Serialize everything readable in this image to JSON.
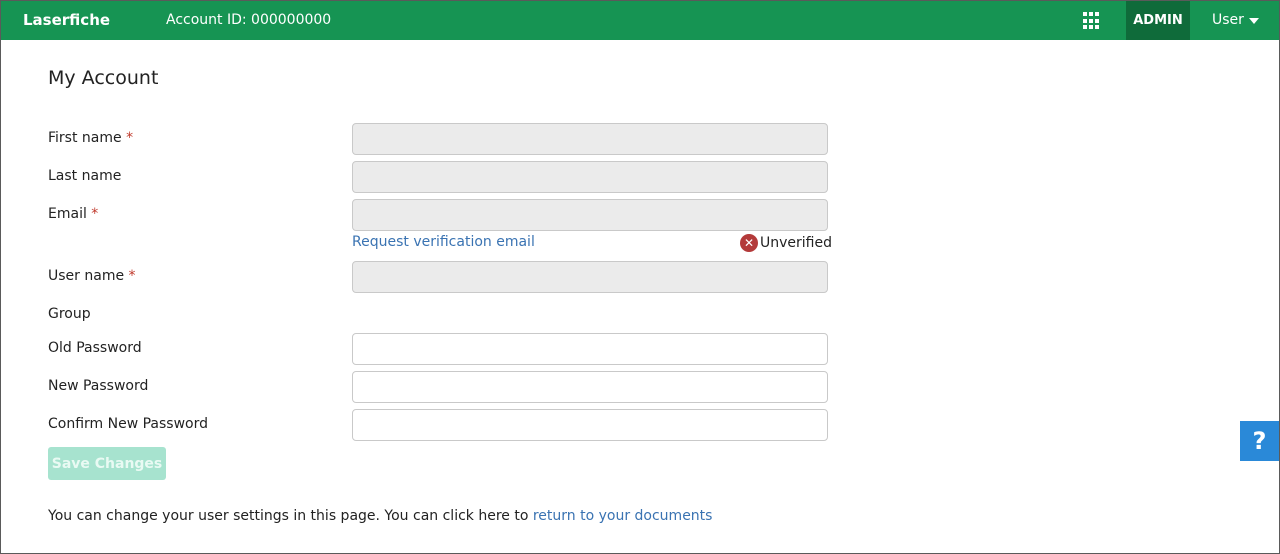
{
  "header": {
    "brand": "Laserfiche",
    "account_id": "Account ID: 000000000",
    "apps_icon": "grid-icon",
    "admin_label": "ADMIN",
    "user_label": "User"
  },
  "page": {
    "title": "My Account"
  },
  "form": {
    "first_name": {
      "label": "First name",
      "required": "*",
      "value": ""
    },
    "last_name": {
      "label": "Last name",
      "value": ""
    },
    "email": {
      "label": "Email",
      "required": "*",
      "value": ""
    },
    "request_verification": "Request verification email",
    "verification_status": "Unverified",
    "verification_icon": "x-circle-icon",
    "user_name": {
      "label": "User name",
      "required": "*",
      "value": ""
    },
    "group": {
      "label": "Group"
    },
    "old_password": {
      "label": "Old Password",
      "value": ""
    },
    "new_password": {
      "label": "New Password",
      "value": ""
    },
    "confirm_password": {
      "label": "Confirm New Password",
      "value": ""
    },
    "save_label": "Save Changes"
  },
  "footer": {
    "text": "You can change your user settings in this page. You can click here to ",
    "link": "return to your documents"
  },
  "help": {
    "label": "?"
  },
  "colors": {
    "header_bg": "#169453",
    "admin_bg": "#0f6b3a",
    "link": "#3a73b2",
    "required": "#c0392b",
    "help_bg": "#2a89d8",
    "save_disabled": "#a7e3cf"
  }
}
